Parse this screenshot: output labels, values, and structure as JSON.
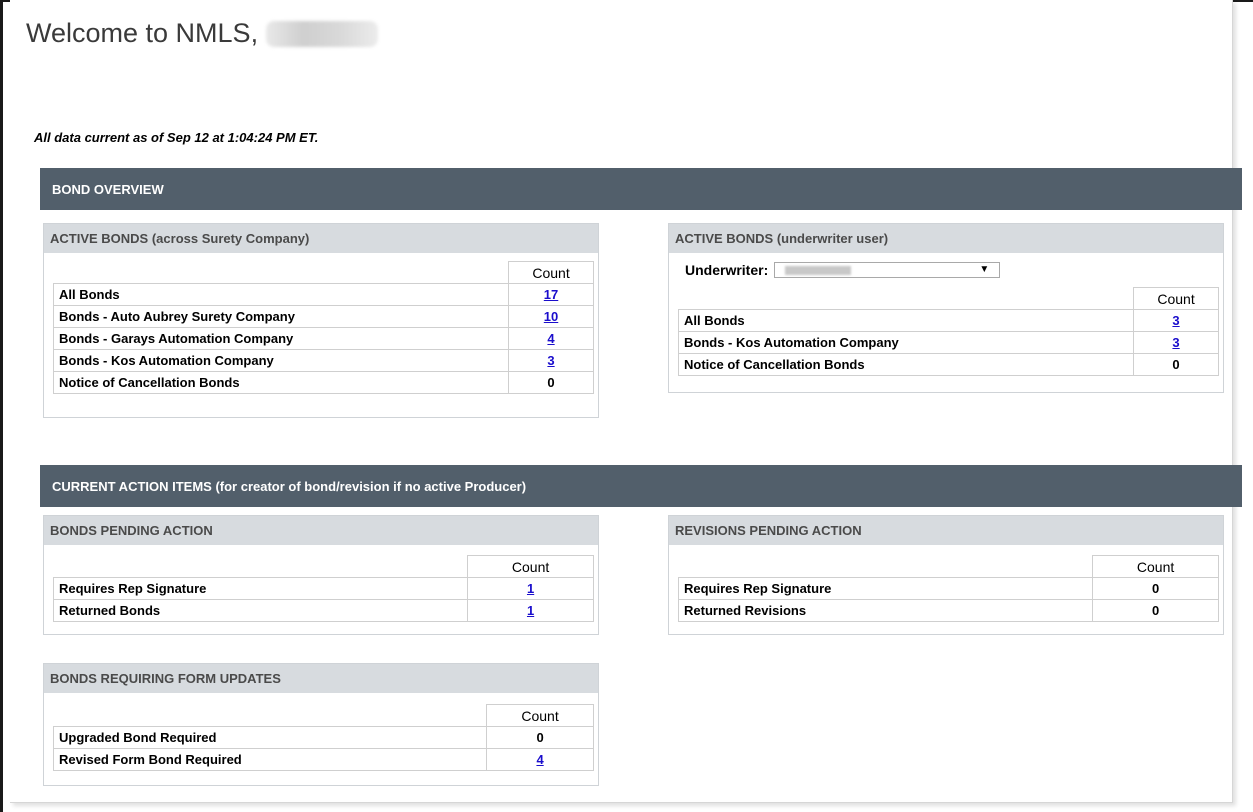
{
  "welcome": {
    "text": "Welcome to NMLS,"
  },
  "data_current": "All data current as of Sep 12 at 1:04:24 PM ET.",
  "bond_overview": {
    "title": "BOND OVERVIEW",
    "active_surety": {
      "title": "ACTIVE BONDS (across Surety Company)",
      "count_header": "Count",
      "rows": [
        {
          "label": "All Bonds",
          "count": "17",
          "link": true
        },
        {
          "label": "Bonds - Auto Aubrey Surety Company",
          "count": "10",
          "link": true
        },
        {
          "label": "Bonds - Garays Automation Company",
          "count": "4",
          "link": true
        },
        {
          "label": "Bonds - Kos Automation Company",
          "count": "3",
          "link": true
        },
        {
          "label": "Notice of Cancellation Bonds",
          "count": "0",
          "link": false
        }
      ]
    },
    "active_underwriter": {
      "title": "ACTIVE BONDS (underwriter user)",
      "underwriter_label": "Underwriter:",
      "arrow": "▼",
      "count_header": "Count",
      "rows": [
        {
          "label": "All Bonds",
          "count": "3",
          "link": true
        },
        {
          "label": "Bonds - Kos Automation Company",
          "count": "3",
          "link": true
        },
        {
          "label": "Notice of Cancellation Bonds",
          "count": "0",
          "link": false
        }
      ]
    }
  },
  "action_items": {
    "title": "CURRENT ACTION ITEMS (for creator of bond/revision if no active Producer)",
    "bonds_pending": {
      "title": "BONDS PENDING ACTION",
      "count_header": "Count",
      "rows": [
        {
          "label": "Requires Rep Signature",
          "count": "1",
          "link": true
        },
        {
          "label": "Returned Bonds",
          "count": "1",
          "link": true
        }
      ]
    },
    "revisions_pending": {
      "title": "REVISIONS PENDING ACTION",
      "count_header": "Count",
      "rows": [
        {
          "label": "Requires Rep Signature",
          "count": "0",
          "link": false
        },
        {
          "label": "Returned Revisions",
          "count": "0",
          "link": false
        }
      ]
    },
    "form_updates": {
      "title": "BONDS REQUIRING FORM UPDATES",
      "count_header": "Count",
      "rows": [
        {
          "label": "Upgraded Bond Required",
          "count": "0",
          "link": false
        },
        {
          "label": "Revised Form Bond Required",
          "count": "4",
          "link": true
        }
      ]
    }
  },
  "colors": {
    "section_bar": "#525f6b",
    "panel_head": "#d7dbdf",
    "link": "#1a0dcc"
  }
}
